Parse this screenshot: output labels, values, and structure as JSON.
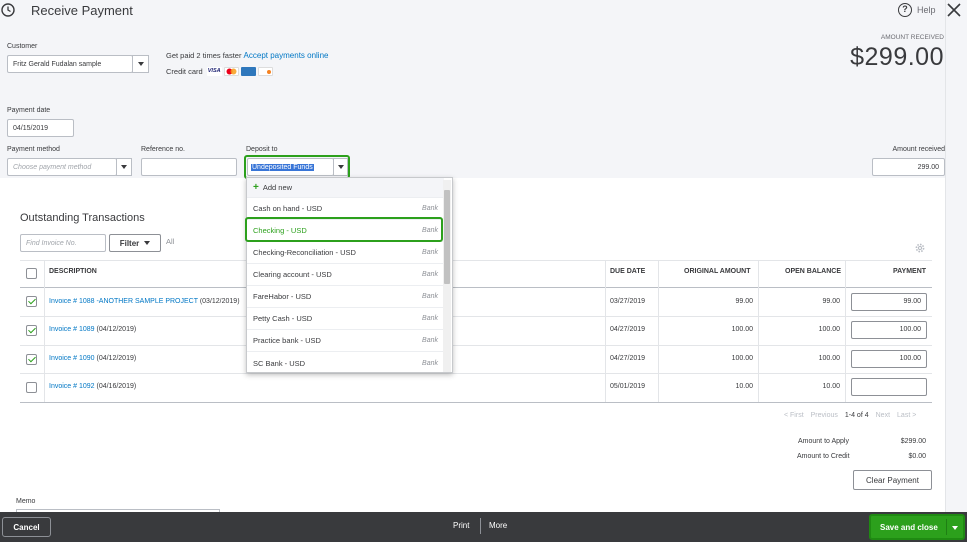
{
  "header": {
    "title": "Receive Payment",
    "help_label": "Help",
    "history_icon": "history-icon",
    "close_icon": "close-icon"
  },
  "customer": {
    "label": "Customer",
    "value": "Fritz Gerald Fudalan sample"
  },
  "promo": {
    "text": "Get paid 2 times faster",
    "link": "Accept payments online",
    "credit_card_label": "Credit card",
    "cards": [
      {
        "name": "VISA",
        "color": "#1a1f71"
      },
      {
        "name": "MC",
        "color": "#eb001b"
      },
      {
        "name": "AMEX",
        "color": "#2e77bc"
      },
      {
        "name": "DISC",
        "color": "#f58220"
      }
    ]
  },
  "amount_received_header": {
    "label": "AMOUNT RECEIVED",
    "value": "$299.00"
  },
  "payment_date": {
    "label": "Payment date",
    "value": "04/15/2019"
  },
  "payment_method": {
    "label": "Payment method",
    "placeholder": "Choose payment method"
  },
  "reference": {
    "label": "Reference no.",
    "value": ""
  },
  "deposit_to": {
    "label": "Deposit to",
    "value": "Undeposited Funds"
  },
  "amount_received": {
    "label": "Amount received",
    "value": "299.00"
  },
  "dropdown": {
    "add_new": "Add new",
    "items": [
      {
        "name": "Cash on hand - USD",
        "type": "Bank"
      },
      {
        "name": "Checking - USD",
        "type": "Bank"
      },
      {
        "name": "Checking-Reconciliation - USD",
        "type": "Bank"
      },
      {
        "name": "Clearing account - USD",
        "type": "Bank"
      },
      {
        "name": "FareHabor - USD",
        "type": "Bank"
      },
      {
        "name": "Petty Cash - USD",
        "type": "Bank"
      },
      {
        "name": "Practice bank - USD",
        "type": "Bank"
      },
      {
        "name": "SC Bank - USD",
        "type": "Bank"
      }
    ],
    "highlighted_index": 1
  },
  "outstanding": {
    "title": "Outstanding Transactions",
    "find_placeholder": "Find Invoice No.",
    "filter_label": "Filter",
    "all_label": "All",
    "columns": {
      "description": "DESCRIPTION",
      "due_date": "DUE DATE",
      "original": "ORIGINAL AMOUNT",
      "open": "OPEN BALANCE",
      "payment": "PAYMENT"
    },
    "rows": [
      {
        "checked": true,
        "link": "Invoice # 1088 -ANOTHER SAMPLE PROJECT",
        "date": "(03/12/2019)",
        "due": "03/27/2019",
        "original": "99.00",
        "open": "99.00",
        "payment": "99.00"
      },
      {
        "checked": true,
        "link": "Invoice # 1089",
        "date": "(04/12/2019)",
        "due": "04/27/2019",
        "original": "100.00",
        "open": "100.00",
        "payment": "100.00"
      },
      {
        "checked": true,
        "link": "Invoice # 1090",
        "date": "(04/12/2019)",
        "due": "04/27/2019",
        "original": "100.00",
        "open": "100.00",
        "payment": "100.00"
      },
      {
        "checked": false,
        "link": "Invoice # 1092",
        "date": "(04/16/2019)",
        "due": "05/01/2019",
        "original": "10.00",
        "open": "10.00",
        "payment": ""
      }
    ]
  },
  "pagination": {
    "first": "< First",
    "previous": "Previous",
    "range": "1-4 of 4",
    "next": "Next",
    "last": "Last >"
  },
  "totals": {
    "apply_label": "Amount to Apply",
    "apply_value": "$299.00",
    "credit_label": "Amount to Credit",
    "credit_value": "$0.00"
  },
  "clear_payment": "Clear Payment",
  "memo_label": "Memo",
  "footer": {
    "cancel": "Cancel",
    "print": "Print",
    "more": "More",
    "save_close": "Save and close"
  }
}
